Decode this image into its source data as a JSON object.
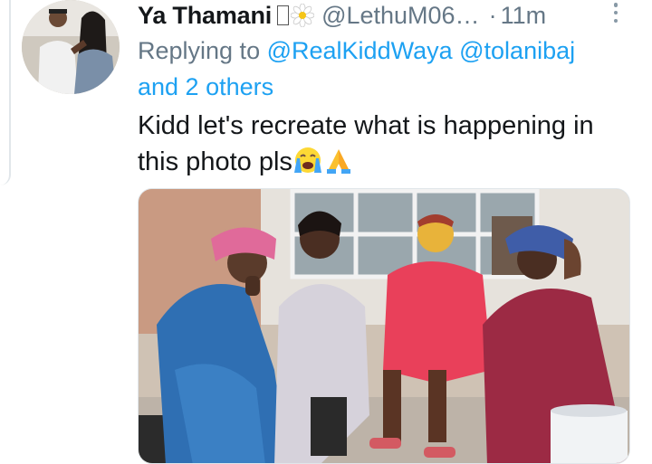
{
  "tweet": {
    "display_name": "Ya Thamani",
    "handle": "@LethuM06…",
    "separator": "·",
    "time": "11m",
    "replying_prefix": "Replying to",
    "mention_1": "@RealKiddWaya",
    "mention_2": "@tolanibaj",
    "mention_others": "and 2 others",
    "text_line_1": "Kidd let's recreate what is happening in",
    "text_line_2": "this photo pls",
    "icons": [
      "missing-glyph",
      "daisy-icon",
      "more-options-icon",
      "crying-face-emoji",
      "folded-hands-emoji"
    ],
    "colors": {
      "link": "#1da1f2",
      "secondary_text": "#657786",
      "primary_text": "#14171a"
    }
  }
}
